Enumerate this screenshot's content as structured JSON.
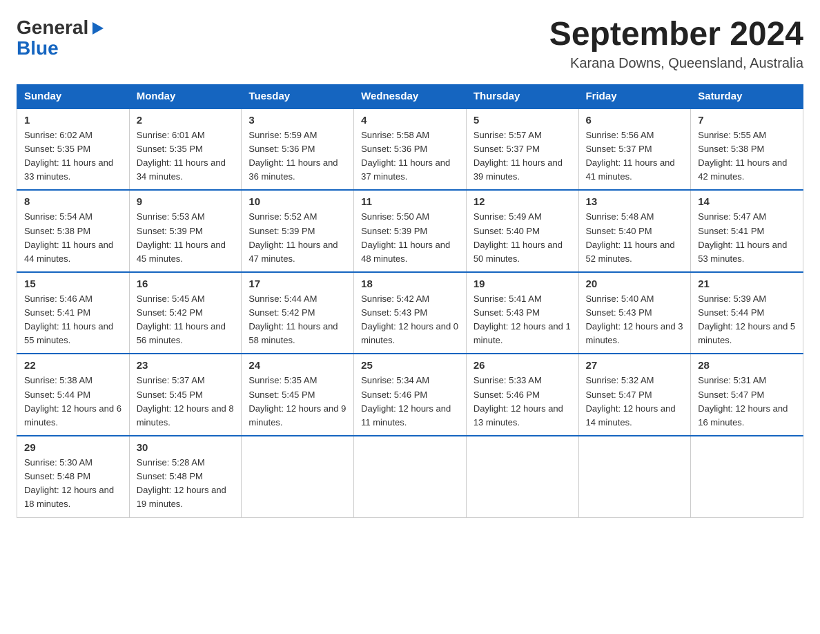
{
  "logo": {
    "general": "General",
    "arrow": "▶",
    "blue": "Blue"
  },
  "title": "September 2024",
  "subtitle": "Karana Downs, Queensland, Australia",
  "weekdays": [
    "Sunday",
    "Monday",
    "Tuesday",
    "Wednesday",
    "Thursday",
    "Friday",
    "Saturday"
  ],
  "weeks": [
    [
      {
        "day": "1",
        "sunrise": "6:02 AM",
        "sunset": "5:35 PM",
        "daylight": "11 hours and 33 minutes."
      },
      {
        "day": "2",
        "sunrise": "6:01 AM",
        "sunset": "5:35 PM",
        "daylight": "11 hours and 34 minutes."
      },
      {
        "day": "3",
        "sunrise": "5:59 AM",
        "sunset": "5:36 PM",
        "daylight": "11 hours and 36 minutes."
      },
      {
        "day": "4",
        "sunrise": "5:58 AM",
        "sunset": "5:36 PM",
        "daylight": "11 hours and 37 minutes."
      },
      {
        "day": "5",
        "sunrise": "5:57 AM",
        "sunset": "5:37 PM",
        "daylight": "11 hours and 39 minutes."
      },
      {
        "day": "6",
        "sunrise": "5:56 AM",
        "sunset": "5:37 PM",
        "daylight": "11 hours and 41 minutes."
      },
      {
        "day": "7",
        "sunrise": "5:55 AM",
        "sunset": "5:38 PM",
        "daylight": "11 hours and 42 minutes."
      }
    ],
    [
      {
        "day": "8",
        "sunrise": "5:54 AM",
        "sunset": "5:38 PM",
        "daylight": "11 hours and 44 minutes."
      },
      {
        "day": "9",
        "sunrise": "5:53 AM",
        "sunset": "5:39 PM",
        "daylight": "11 hours and 45 minutes."
      },
      {
        "day": "10",
        "sunrise": "5:52 AM",
        "sunset": "5:39 PM",
        "daylight": "11 hours and 47 minutes."
      },
      {
        "day": "11",
        "sunrise": "5:50 AM",
        "sunset": "5:39 PM",
        "daylight": "11 hours and 48 minutes."
      },
      {
        "day": "12",
        "sunrise": "5:49 AM",
        "sunset": "5:40 PM",
        "daylight": "11 hours and 50 minutes."
      },
      {
        "day": "13",
        "sunrise": "5:48 AM",
        "sunset": "5:40 PM",
        "daylight": "11 hours and 52 minutes."
      },
      {
        "day": "14",
        "sunrise": "5:47 AM",
        "sunset": "5:41 PM",
        "daylight": "11 hours and 53 minutes."
      }
    ],
    [
      {
        "day": "15",
        "sunrise": "5:46 AM",
        "sunset": "5:41 PM",
        "daylight": "11 hours and 55 minutes."
      },
      {
        "day": "16",
        "sunrise": "5:45 AM",
        "sunset": "5:42 PM",
        "daylight": "11 hours and 56 minutes."
      },
      {
        "day": "17",
        "sunrise": "5:44 AM",
        "sunset": "5:42 PM",
        "daylight": "11 hours and 58 minutes."
      },
      {
        "day": "18",
        "sunrise": "5:42 AM",
        "sunset": "5:43 PM",
        "daylight": "12 hours and 0 minutes."
      },
      {
        "day": "19",
        "sunrise": "5:41 AM",
        "sunset": "5:43 PM",
        "daylight": "12 hours and 1 minute."
      },
      {
        "day": "20",
        "sunrise": "5:40 AM",
        "sunset": "5:43 PM",
        "daylight": "12 hours and 3 minutes."
      },
      {
        "day": "21",
        "sunrise": "5:39 AM",
        "sunset": "5:44 PM",
        "daylight": "12 hours and 5 minutes."
      }
    ],
    [
      {
        "day": "22",
        "sunrise": "5:38 AM",
        "sunset": "5:44 PM",
        "daylight": "12 hours and 6 minutes."
      },
      {
        "day": "23",
        "sunrise": "5:37 AM",
        "sunset": "5:45 PM",
        "daylight": "12 hours and 8 minutes."
      },
      {
        "day": "24",
        "sunrise": "5:35 AM",
        "sunset": "5:45 PM",
        "daylight": "12 hours and 9 minutes."
      },
      {
        "day": "25",
        "sunrise": "5:34 AM",
        "sunset": "5:46 PM",
        "daylight": "12 hours and 11 minutes."
      },
      {
        "day": "26",
        "sunrise": "5:33 AM",
        "sunset": "5:46 PM",
        "daylight": "12 hours and 13 minutes."
      },
      {
        "day": "27",
        "sunrise": "5:32 AM",
        "sunset": "5:47 PM",
        "daylight": "12 hours and 14 minutes."
      },
      {
        "day": "28",
        "sunrise": "5:31 AM",
        "sunset": "5:47 PM",
        "daylight": "12 hours and 16 minutes."
      }
    ],
    [
      {
        "day": "29",
        "sunrise": "5:30 AM",
        "sunset": "5:48 PM",
        "daylight": "12 hours and 18 minutes."
      },
      {
        "day": "30",
        "sunrise": "5:28 AM",
        "sunset": "5:48 PM",
        "daylight": "12 hours and 19 minutes."
      },
      null,
      null,
      null,
      null,
      null
    ]
  ]
}
